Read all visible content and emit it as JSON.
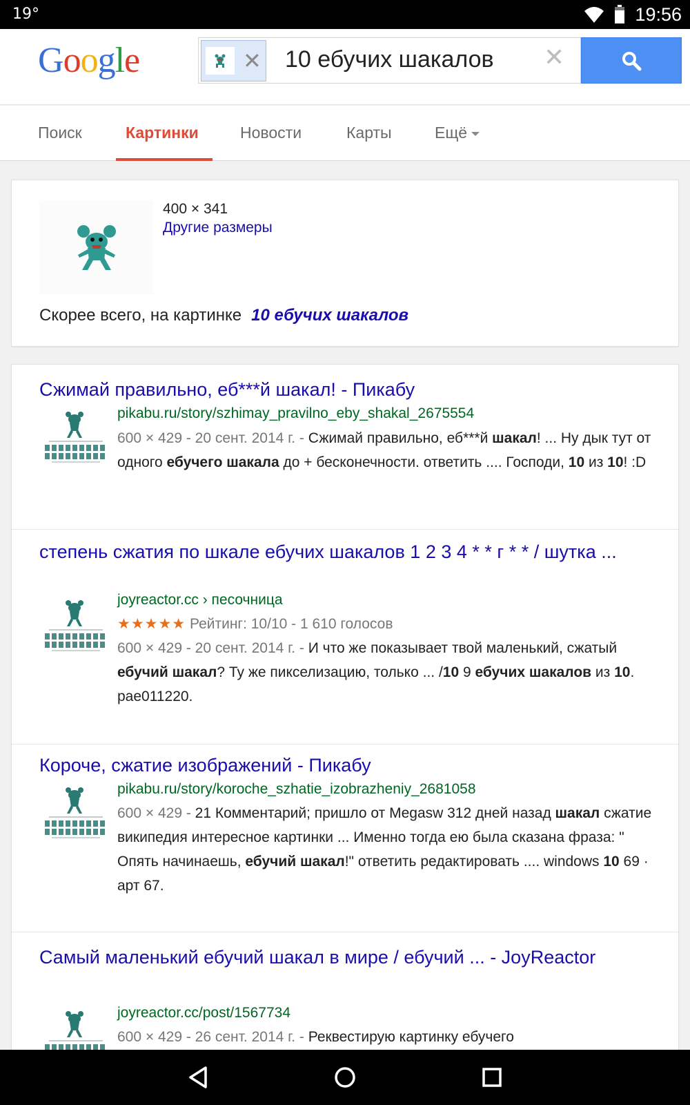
{
  "status_bar": {
    "temperature": "19°",
    "time": "19:56"
  },
  "header": {
    "logo_letters": [
      {
        "char": "G",
        "color": "#3b6fd8"
      },
      {
        "char": "o",
        "color": "#dd3c2a"
      },
      {
        "char": "o",
        "color": "#f2b20f"
      },
      {
        "char": "g",
        "color": "#3b6fd8"
      },
      {
        "char": "l",
        "color": "#2e9b46"
      },
      {
        "char": "e",
        "color": "#dd3c2a"
      }
    ],
    "search_query": "10 ебучих шакалов",
    "clear_glyph": "✕",
    "chip_close_glyph": "✕",
    "search_icon": "search-icon"
  },
  "tabs": [
    {
      "label": "Поиск",
      "active": false
    },
    {
      "label": "Картинки",
      "active": true
    },
    {
      "label": "Новости",
      "active": false
    },
    {
      "label": "Карты",
      "active": false
    },
    {
      "label": "Ещё",
      "active": false
    }
  ],
  "image_info": {
    "size": "400 × 341",
    "other_sizes": "Другие размеры",
    "best_guess_prefix": "Скорее всего, на картинке",
    "best_guess": "10 ебучих шакалов"
  },
  "results": [
    {
      "title": "Сжимай правильно, еб***й шакал! - Пикабу",
      "url": "pikabu.ru/story/szhimay_pravilno_eby_shakal_2675554",
      "meta": "600 × 429 - 20 сент. 2014 г. - ",
      "snippet": [
        {
          "t": "Сжимай правильно, еб***й "
        },
        {
          "t": "шакал",
          "b": true
        },
        {
          "t": "! ... Ну дык тут от одного "
        },
        {
          "t": "ебучего шакала",
          "b": true
        },
        {
          "t": " до + бесконечности. ответить .... Господи, "
        },
        {
          "t": "10",
          "b": true
        },
        {
          "t": " из "
        },
        {
          "t": "10",
          "b": true
        },
        {
          "t": "! :D"
        }
      ]
    },
    {
      "title": "степень сжатия по шкале ебучих шакалов 1 2 3 4 * * г * * / шутка ...",
      "url": "joyreactor.cc › песочница",
      "stars": "★★★★★",
      "rating": "Рейтинг: 10/10 - 1 610 голосов",
      "meta": "600 × 429 - 20 сент. 2014 г. - ",
      "snippet": [
        {
          "t": "И что же показывает твой маленький, сжатый "
        },
        {
          "t": "ебучий шакал",
          "b": true
        },
        {
          "t": "? Ту же пикселизацию, только ... /"
        },
        {
          "t": "10",
          "b": true
        },
        {
          "t": " 9 "
        },
        {
          "t": "ебучих шакалов",
          "b": true
        },
        {
          "t": " из "
        },
        {
          "t": "10",
          "b": true
        },
        {
          "t": ". pae011220."
        }
      ]
    },
    {
      "title": "Короче, сжатие изображений - Пикабу",
      "url": "pikabu.ru/story/koroche_szhatie_izobrazheniy_2681058",
      "meta": "600 × 429 - ",
      "snippet": [
        {
          "t": "21 Комментарий; пришло от Megasw 312 дней назад "
        },
        {
          "t": "шакал",
          "b": true
        },
        {
          "t": " сжатие википедия интересное картинки ... Именно тогда ею была сказана фраза: \" Опять начинаешь, "
        },
        {
          "t": "ебучий шакал",
          "b": true
        },
        {
          "t": "!\" ответить редактировать .... windows "
        },
        {
          "t": "10",
          "b": true
        },
        {
          "t": " 69 · арт 67."
        }
      ]
    },
    {
      "title": "Самый маленький ебучий шакал в мире / ебучий ... - JoyReactor",
      "url": "joyreactor.cc/post/1567734",
      "meta": "600 × 429 - 26 сент. 2014 г. - ",
      "snippet": [
        {
          "t": "Реквестирую картинку ебучего"
        }
      ]
    }
  ],
  "nav_bar": {
    "back": "back-icon",
    "home": "home-icon",
    "recents": "recents-icon"
  }
}
